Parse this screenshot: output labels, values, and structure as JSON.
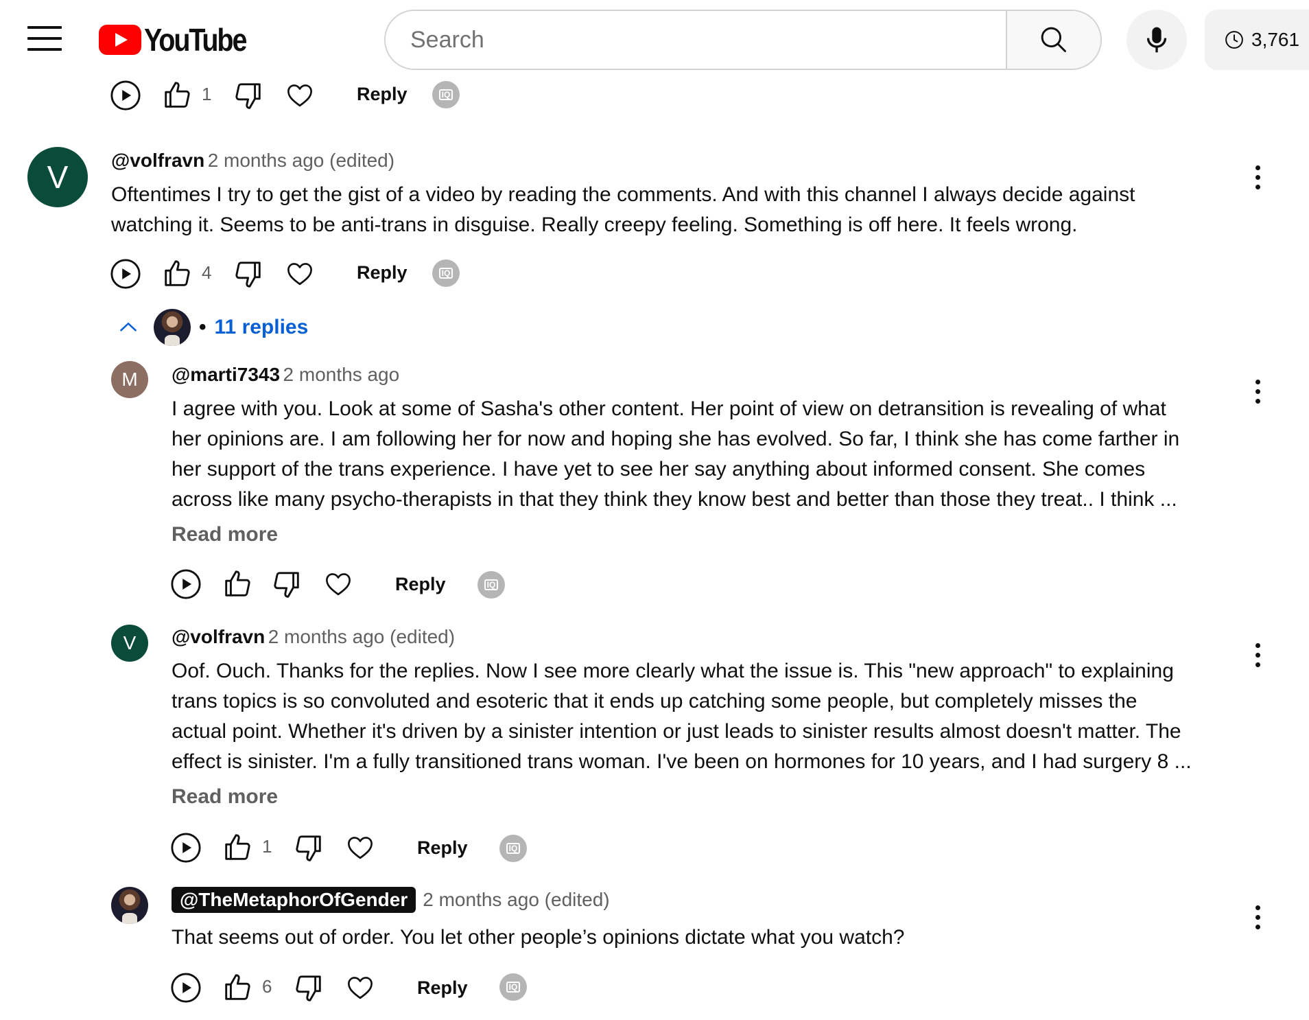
{
  "header": {
    "logo_text": "YouTube",
    "search_placeholder": "Search",
    "history_count": "3,761"
  },
  "top_actions": {
    "like_count": "1",
    "reply_label": "Reply",
    "ext_label": "IQ"
  },
  "comments": [
    {
      "avatar_letter": "V",
      "avatar_color": "#0b4b3a",
      "author": "@volfravn",
      "meta": "2 months ago (edited)",
      "text_lines": [
        "Oftentimes I try to get the gist of a video by reading the comments. And with this channel I always decide against",
        "watching it. Seems to be anti-trans in disguise. Really creepy feeling. Something is off here. It feels wrong."
      ],
      "like_count": "4",
      "reply_label": "Reply",
      "replies_label": "11 replies",
      "replies_dot": "•"
    }
  ],
  "replies": [
    {
      "avatar_letter": "M",
      "avatar_color": "#8d6e63",
      "author": "@marti7343",
      "meta": "2 months ago",
      "text_lines": [
        "I agree with you.  Look at some of Sasha's other content.  Her point of view on detransition is revealing of what",
        "her opinions are.  I am following her for now and hoping she has evolved.  So far, I think she has come farther in",
        "her support of the trans experience.  I have yet to see her say anything about informed consent.  She comes",
        "across like many psycho-therapists in that they think they know best and better than those they treat..  I think ..."
      ],
      "read_more": "Read more",
      "like_count": "",
      "reply_label": "Reply"
    },
    {
      "avatar_letter": "V",
      "avatar_color": "#0b4b3a",
      "author": "@volfravn",
      "meta": "2 months ago (edited)",
      "text_lines": [
        "Oof. Ouch. Thanks for the replies. Now I see more clearly what the issue is. This \"new approach\" to explaining",
        "trans topics is so convoluted and esoteric that it ends up catching some people, but completely misses the",
        "actual point. Whether it's driven by a sinister intention or just leads to sinister results almost doesn't matter. The",
        "effect is sinister. I'm a fully transitioned trans woman. I've been on hormones for 10 years, and I had surgery 8 ..."
      ],
      "read_more": "Read more",
      "like_count": "1",
      "reply_label": "Reply"
    },
    {
      "author": "@TheMetaphorOfGender",
      "meta": "2 months ago (edited)",
      "text_lines": [
        "That seems out of order. You let other people’s opinions dictate what you watch?"
      ],
      "like_count": "6",
      "reply_label": "Reply"
    }
  ]
}
